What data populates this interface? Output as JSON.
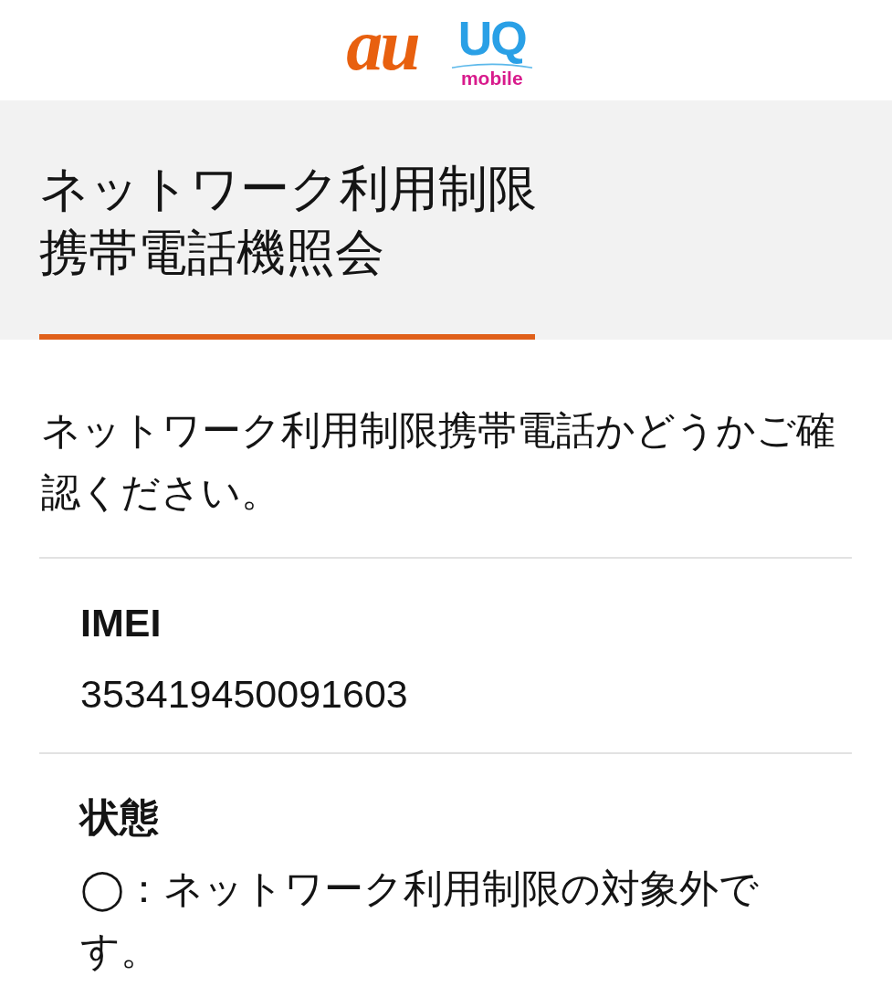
{
  "header": {
    "logos": [
      {
        "kind": "au",
        "text": "au"
      },
      {
        "kind": "uq",
        "text": "UQ",
        "subtext": "mobile"
      }
    ]
  },
  "page_title": {
    "lines": [
      "ネットワーク利用制限",
      "携帯電話機照会"
    ]
  },
  "description": "ネットワーク利用制限携帯電話かどうかご確認ください。",
  "details": [
    {
      "label": "IMEI",
      "value": "353419450091603"
    },
    {
      "label": "状態",
      "value": "◯：ネットワーク利用制限の対象外です。"
    }
  ]
}
